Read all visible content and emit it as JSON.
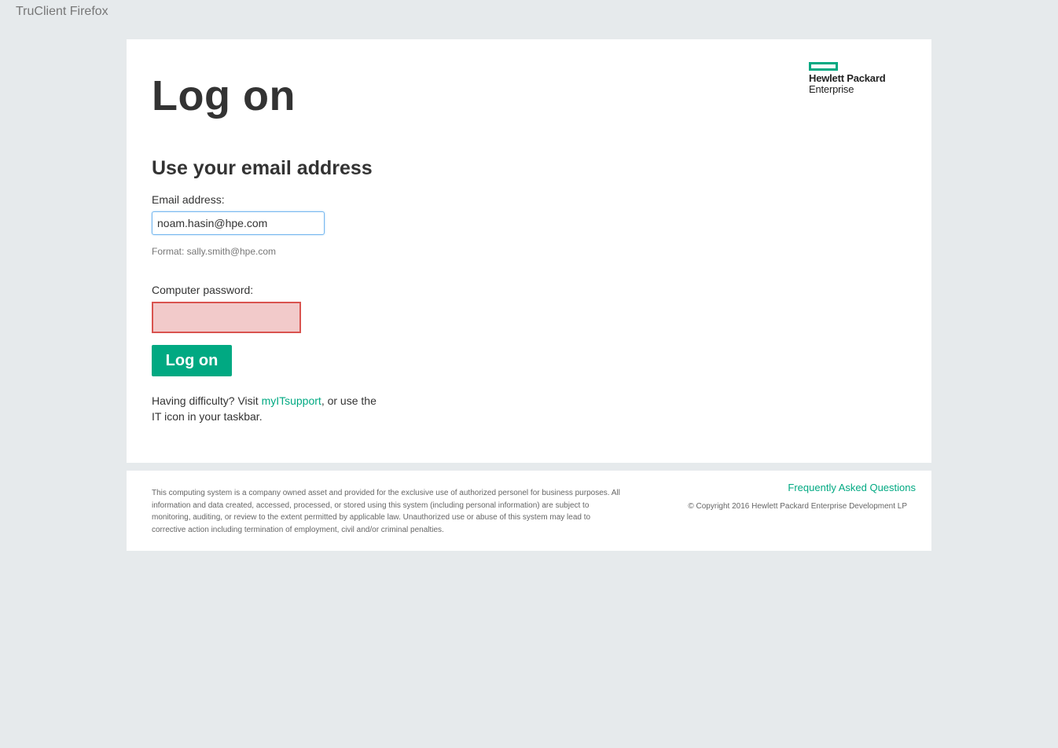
{
  "window": {
    "title": "TruClient Firefox"
  },
  "header": {
    "title": "Log on",
    "logo": {
      "line1": "Hewlett Packard",
      "line2": "Enterprise"
    }
  },
  "form": {
    "heading": "Use your email address",
    "email_label": "Email address:",
    "email_value": "noam.hasin@hpe.com",
    "email_hint": "Format: sally.smith@hpe.com",
    "password_label": "Computer password:",
    "password_value": "",
    "submit_label": "Log on"
  },
  "help": {
    "prefix": "Having difficulty? Visit ",
    "link_text": "myITsupport",
    "suffix": ", or use the IT icon in your taskbar."
  },
  "footer": {
    "disclaimer": "This computing system is a company owned asset and provided for the exclusive use of authorized personel for business purposes. All information and data created, accessed, processed, or stored using this system (including personal information) are subject to monitoring, auditing, or review to the extent permitted by applicable law. Unauthorized use or abuse of this system may lead to corrective action including termination of employment, civil and/or criminal penalties.",
    "faq_label": "Frequently Asked Questions",
    "copyright": "© Copyright 2016 Hewlett Packard Enterprise Development LP"
  },
  "colors": {
    "accent": "#01a982",
    "background": "#e6eaec",
    "error_border": "#d9534f",
    "error_fill": "#f2caca"
  }
}
